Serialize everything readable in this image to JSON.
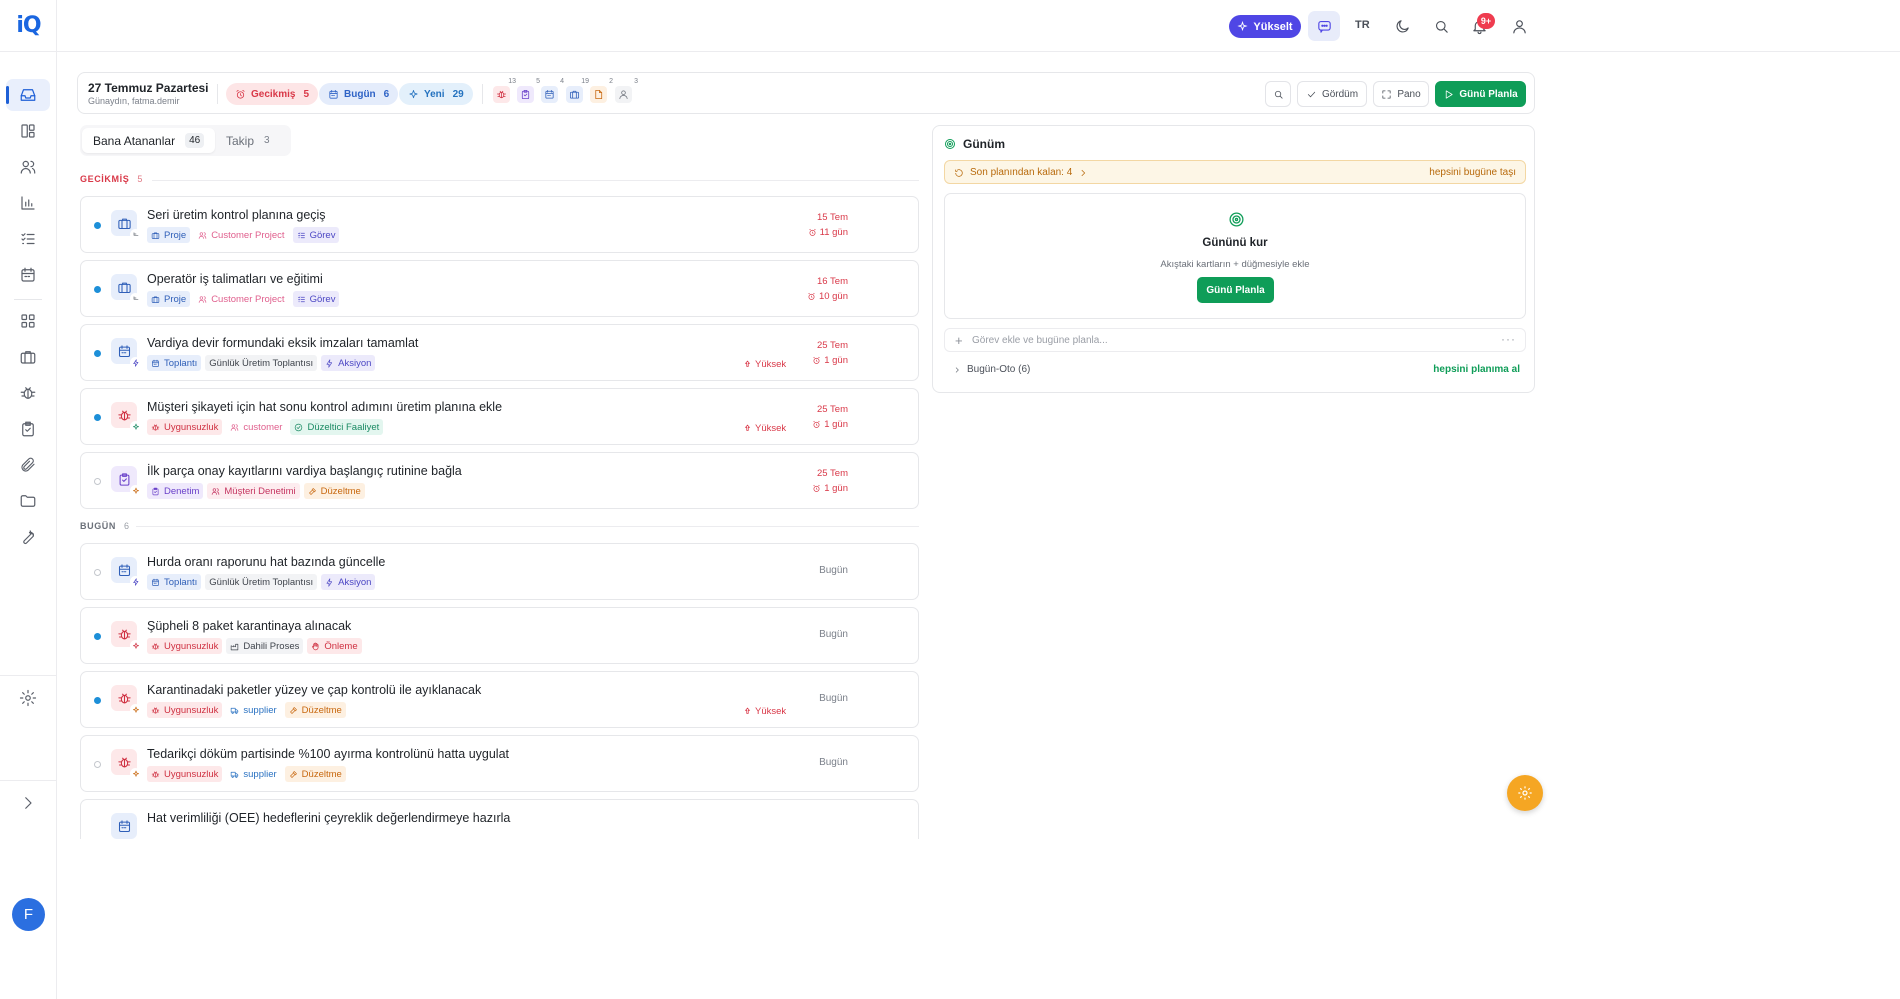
{
  "app": {
    "logo": "iQ",
    "language": "TR",
    "upgrade_label": "Yükselt",
    "notification_count": "9+"
  },
  "sidebar": {
    "items": [
      "inbox-icon",
      "dashboard-icon",
      "users-icon",
      "chart-icon",
      "checklist-icon",
      "calendar-icon",
      "grid-icon",
      "briefcase-icon",
      "bug-icon",
      "clipboard-icon",
      "paperclip-icon",
      "folder-icon",
      "wrench-icon"
    ],
    "settings_icon": "gear-icon",
    "avatar_letter": "F",
    "expand_icon": "chevron-right-icon"
  },
  "header": {
    "date": "27 Temmuz Pazartesi",
    "greeting": "Günaydın, fatma.demir",
    "pills": [
      {
        "label": "Gecikmiş",
        "count": "5"
      },
      {
        "label": "Bugün",
        "count": "6"
      },
      {
        "label": "Yeni",
        "count": "29"
      }
    ],
    "type_counts": [
      "13",
      "5",
      "4",
      "19",
      "2",
      "3"
    ],
    "seen_label": "Gördüm",
    "board_label": "Pano",
    "plan_label": "Günü Planla"
  },
  "tabs": [
    {
      "label": "Bana Atananlar",
      "count": "46"
    },
    {
      "label": "Takip",
      "count": "3"
    }
  ],
  "sections": {
    "overdue": {
      "title": "GECİKMİŞ",
      "count": "5"
    },
    "today": {
      "title": "BUGÜN",
      "count": "6"
    }
  },
  "overdue_tasks": [
    {
      "title": "Seri üretim kontrol planına geçiş",
      "tags": [
        "Proje",
        "Customer Project",
        "Görev"
      ],
      "priority": "",
      "date": "15 Tem",
      "ago": "11 gün"
    },
    {
      "title": "Operatör iş talimatları ve eğitimi",
      "tags": [
        "Proje",
        "Customer Project",
        "Görev"
      ],
      "priority": "",
      "date": "16 Tem",
      "ago": "10 gün"
    },
    {
      "title": "Vardiya devir formundaki eksik imzaları tamamlat",
      "tags": [
        "Toplantı",
        "Günlük Üretim Toplantısı",
        "Aksiyon"
      ],
      "priority": "Yüksek",
      "date": "25 Tem",
      "ago": "1 gün"
    },
    {
      "title": "Müşteri şikayeti için hat sonu kontrol adımını üretim planına ekle",
      "tags": [
        "Uygunsuzluk",
        "customer",
        "Düzeltici Faaliyet"
      ],
      "priority": "Yüksek",
      "date": "25 Tem",
      "ago": "1 gün"
    },
    {
      "title": "İlk parça onay kayıtlarını vardiya başlangıç rutinine bağla",
      "tags": [
        "Denetim",
        "Müşteri Denetimi",
        "Düzeltme"
      ],
      "priority": "",
      "date": "25 Tem",
      "ago": "1 gün"
    }
  ],
  "today_tasks": [
    {
      "title": "Hurda oranı raporunu hat bazında güncelle",
      "tags": [
        "Toplantı",
        "Günlük Üretim Toplantısı",
        "Aksiyon"
      ],
      "priority": "",
      "due": "Bugün"
    },
    {
      "title": "Şüpheli 8 paket karantinaya alınacak",
      "tags": [
        "Uygunsuzluk",
        "Dahili Proses",
        "Önleme"
      ],
      "priority": "",
      "due": "Bugün"
    },
    {
      "title": "Karantinadaki paketler yüzey ve çap kontrolü ile ayıklanacak",
      "tags": [
        "Uygunsuzluk",
        "supplier",
        "Düzeltme"
      ],
      "priority": "Yüksek",
      "due": "Bugün"
    },
    {
      "title": "Tedarikçi döküm partisinde %100 ayırma kontrolünü hatta uygulat",
      "tags": [
        "Uygunsuzluk",
        "supplier",
        "Düzeltme"
      ],
      "priority": "",
      "due": "Bugün"
    },
    {
      "title": "Hat verimliliği (OEE) hedeflerini çeyreklik değerlendirmeye hazırla"
    }
  ],
  "my_day": {
    "title": "Günüm",
    "carryover": "Son planından kalan: 4",
    "carryover_action": "hepsini bugüne taşı",
    "setup_title": "Gününü kur",
    "setup_hint": "Akıştaki kartların + düğmesiyle ekle",
    "setup_button": "Günü Planla",
    "add_placeholder": "Görev ekle ve bugüne planla...",
    "auto_label": "Bugün-Oto (6)",
    "auto_action": "hepsini planıma al"
  }
}
